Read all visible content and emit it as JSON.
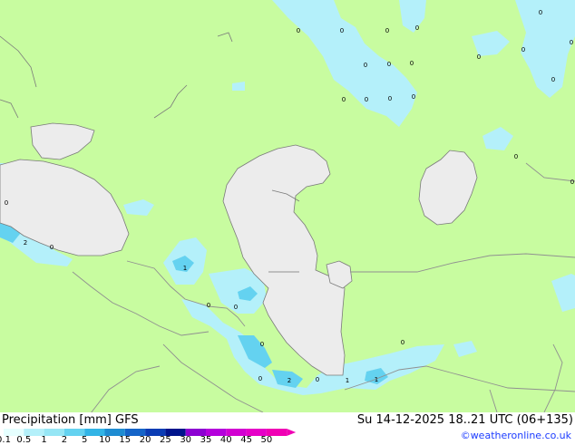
{
  "map": {
    "labels": [
      {
        "text": "0"
      },
      {
        "text": "0"
      },
      {
        "text": "0"
      },
      {
        "text": "0"
      },
      {
        "text": "0"
      },
      {
        "text": "0"
      },
      {
        "text": "0"
      },
      {
        "text": "0"
      },
      {
        "text": "0"
      },
      {
        "text": "0"
      },
      {
        "text": "0"
      },
      {
        "text": "0"
      },
      {
        "text": "0"
      },
      {
        "text": "0"
      },
      {
        "text": "0"
      },
      {
        "text": "0"
      },
      {
        "text": "0"
      },
      {
        "text": "0"
      },
      {
        "text": "2"
      },
      {
        "text": "0"
      },
      {
        "text": "1"
      },
      {
        "text": "0"
      },
      {
        "text": "0"
      },
      {
        "text": "0"
      },
      {
        "text": "0"
      },
      {
        "text": "2"
      },
      {
        "text": "0"
      },
      {
        "text": "1"
      },
      {
        "text": "1"
      },
      {
        "text": "0"
      }
    ],
    "colors": {
      "land": "#c8fca0",
      "sea": "#ececec",
      "border": "#909090"
    }
  },
  "legend": {
    "title": "Precipitation [mm]  GFS",
    "datetime": "Su 14-12-2025 18..21 UTC (06+135)",
    "credit": "©weatheronline.co.uk",
    "scale": [
      {
        "label": "0.1",
        "color": "#e6ffff"
      },
      {
        "label": "0.5",
        "color": "#b4f0fa"
      },
      {
        "label": "1",
        "color": "#96e6f5"
      },
      {
        "label": "2",
        "color": "#64d2f0"
      },
      {
        "label": "5",
        "color": "#32b4e6"
      },
      {
        "label": "10",
        "color": "#1e8cd2"
      },
      {
        "label": "15",
        "color": "#1464c8"
      },
      {
        "label": "20",
        "color": "#0a3cb4"
      },
      {
        "label": "25",
        "color": "#00148c"
      },
      {
        "label": "30",
        "color": "#8c00d2"
      },
      {
        "label": "35",
        "color": "#b400dc"
      },
      {
        "label": "40",
        "color": "#d200d2"
      },
      {
        "label": "45",
        "color": "#e600c8"
      },
      {
        "label": "50",
        "color": "#f000b4"
      }
    ]
  }
}
